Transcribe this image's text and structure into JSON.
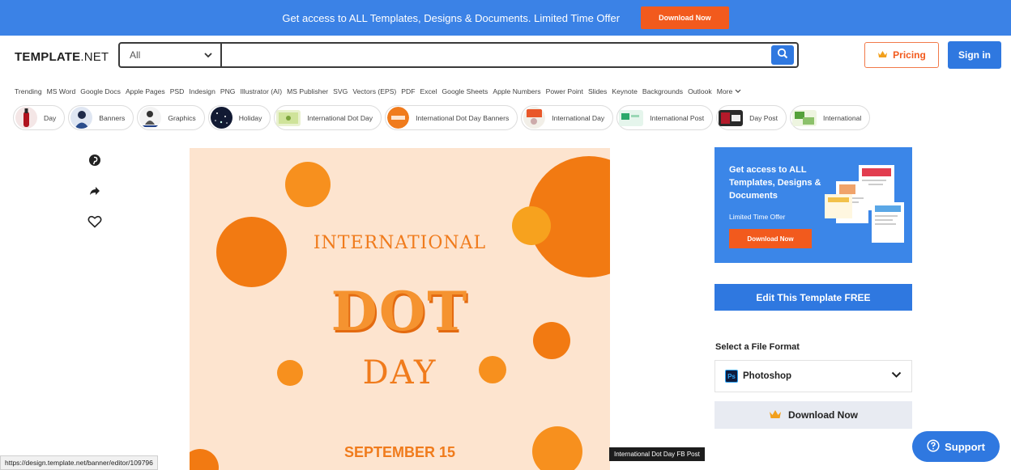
{
  "banner": {
    "text": "Get access to ALL Templates, Designs & Documents. Limited Time Offer",
    "button_label": "Download Now"
  },
  "header": {
    "logo_bold": "TEMPLATE",
    "logo_light": ".NET",
    "search_category": "All",
    "search_value": "",
    "pricing_label": "Pricing",
    "signin_label": "Sign in"
  },
  "nav": {
    "items": [
      "Trending",
      "MS Word",
      "Google Docs",
      "Apple Pages",
      "PSD",
      "Indesign",
      "PNG",
      "Illustrator (AI)",
      "MS Publisher",
      "SVG",
      "Vectors (EPS)",
      "PDF",
      "Excel",
      "Google Sheets",
      "Apple Numbers",
      "Power Point",
      "Slides",
      "Keynote",
      "Backgrounds",
      "Outlook",
      "More"
    ]
  },
  "chips": [
    {
      "label": "Day"
    },
    {
      "label": "Banners"
    },
    {
      "label": "Graphics"
    },
    {
      "label": "Holiday"
    },
    {
      "label": "International Dot Day"
    },
    {
      "label": "International Dot Day Banners"
    },
    {
      "label": "International Day"
    },
    {
      "label": "International Post"
    },
    {
      "label": "Day Post"
    },
    {
      "label": "International"
    }
  ],
  "preview": {
    "line1": "INTERNATIONAL",
    "line2": "DOT",
    "line3": "DAY",
    "date": "SEPTEMBER 15"
  },
  "promo": {
    "title": "Get access to ALL Templates, Designs & Documents",
    "subtitle": "Limited Time Offer",
    "button_label": "Download Now"
  },
  "sidebar": {
    "edit_label": "Edit This Template FREE",
    "format_heading": "Select a File Format",
    "format_value": "Photoshop",
    "format_icon_text": "Ps",
    "download_label": "Download Now"
  },
  "tooltip": "International Dot Day FB Post",
  "status_url": "https://design.template.net/banner/editor/109796",
  "support_label": "Support",
  "colors": {
    "brand_blue": "#2f78e0",
    "accent_orange": "#f25a1d",
    "preview_bg": "#fde4cf",
    "dot_orange": "#f7901e"
  }
}
